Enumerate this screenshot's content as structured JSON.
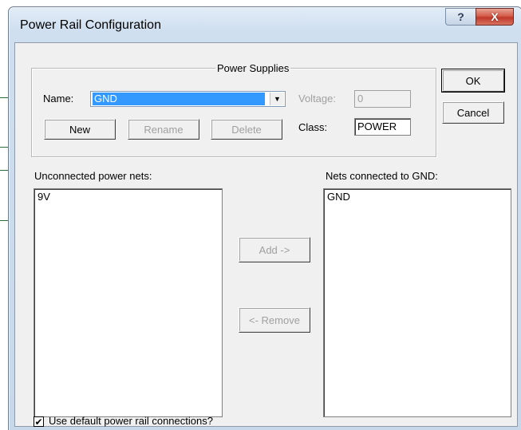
{
  "window": {
    "title": "Power Rail Configuration",
    "help_glyph": "?",
    "close_glyph": "X"
  },
  "group": {
    "legend": "Power Supplies"
  },
  "name": {
    "label": "Name:",
    "value": "GND"
  },
  "voltage": {
    "label": "Voltage:",
    "value": "0"
  },
  "class": {
    "label": "Class:",
    "value": "POWER"
  },
  "buttons": {
    "new": "New",
    "rename": "Rename",
    "delete": "Delete",
    "ok": "OK",
    "cancel": "Cancel",
    "add": "Add ->",
    "remove": "<- Remove"
  },
  "unconnected": {
    "label": "Unconnected power nets:",
    "items": [
      "9V"
    ]
  },
  "connected": {
    "label": "Nets connected to GND:",
    "items": [
      "GND"
    ]
  },
  "checkbox": {
    "label": "Use default power rail connections?",
    "checked": true,
    "mark": "✔"
  }
}
